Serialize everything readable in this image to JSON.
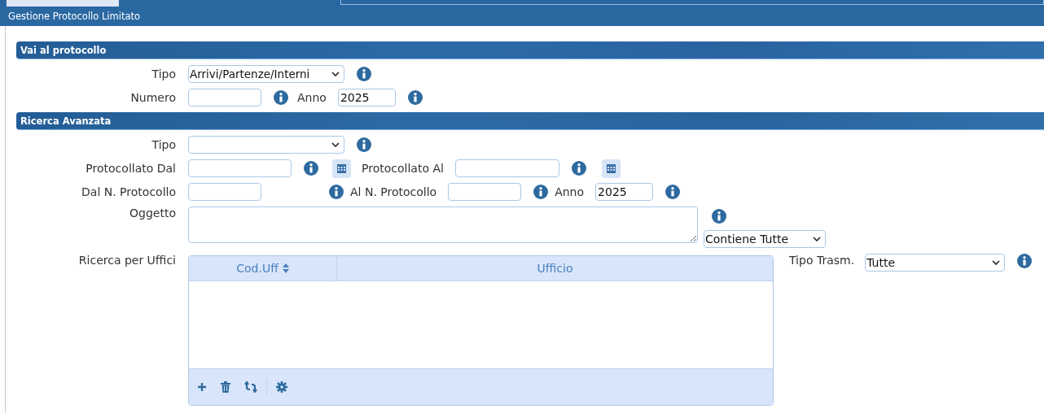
{
  "window": {
    "title": "Gestione Protocollo Limitato"
  },
  "vai_al_protocollo": {
    "title": "Vai al protocollo",
    "tipo": {
      "label": "Tipo",
      "value": "Arrivi/Partenze/Interni"
    },
    "numero": {
      "label": "Numero"
    },
    "anno": {
      "label": "Anno",
      "value": "2025"
    }
  },
  "ricerca_avanzata": {
    "title": "Ricerca Avanzata",
    "tipo": {
      "label": "Tipo"
    },
    "protocollato_dal": {
      "label": "Protocollato Dal"
    },
    "protocollato_al": {
      "label": "Protocollato Al"
    },
    "dal_n_protocollo": {
      "label": "Dal N. Protocollo"
    },
    "al_n_protocollo": {
      "label": "Al N. Protocollo"
    },
    "anno": {
      "label": "Anno",
      "value": "2025"
    },
    "oggetto": {
      "label": "Oggetto"
    },
    "oggetto_mode": {
      "value": "Contiene Tutte"
    },
    "ricerca_per_uffici": {
      "label": "Ricerca per Uffici",
      "columns": [
        {
          "label": "Cod.Uff",
          "sortable": true
        },
        {
          "label": "Ufficio",
          "sortable": false
        }
      ]
    },
    "tipo_trasm": {
      "label": "Tipo Trasm.",
      "value": "Tutte"
    }
  }
}
